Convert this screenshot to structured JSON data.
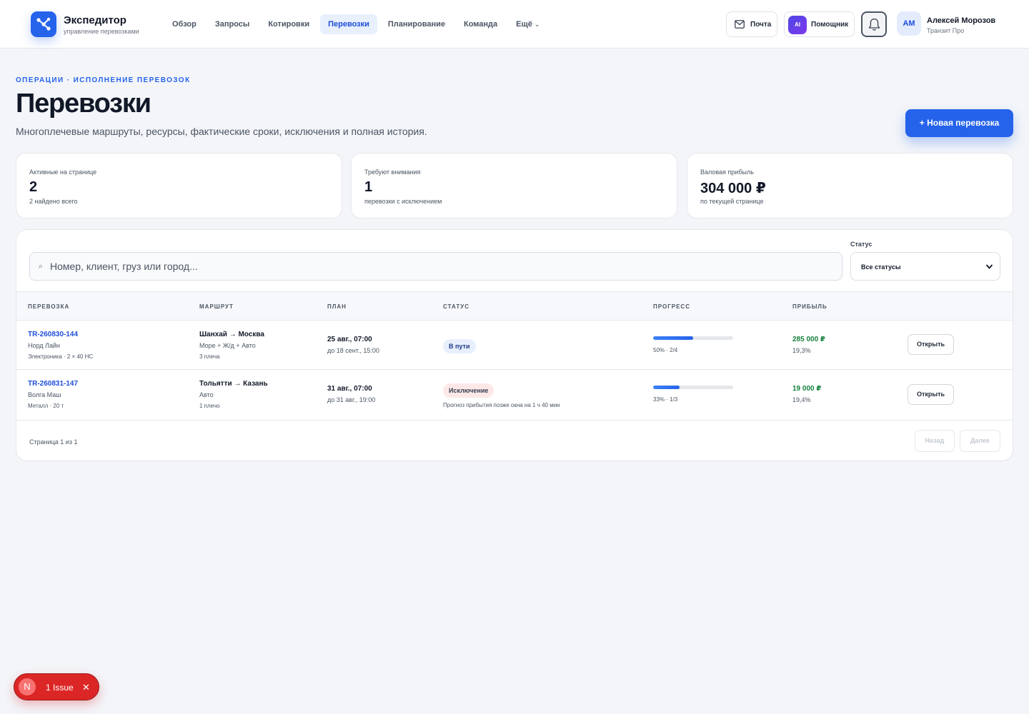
{
  "app": {
    "name": "Экспедитор",
    "subtitle": "управление перевозками"
  },
  "nav": [
    {
      "label": "Обзор"
    },
    {
      "label": "Запросы"
    },
    {
      "label": "Котировки"
    },
    {
      "label": "Перевозки",
      "active": true
    },
    {
      "label": "Планирование"
    },
    {
      "label": "Команда"
    },
    {
      "label": "Ещё"
    }
  ],
  "header_actions": {
    "mail": "Почта",
    "assistant_badge": "AI",
    "assistant": "Помощник"
  },
  "user": {
    "initials": "АМ",
    "name": "Алексей Морозов",
    "org": "Транзит Про"
  },
  "page": {
    "eyebrow": "ОПЕРАЦИИ · ИСПОЛНЕНИЕ ПЕРЕВОЗОК",
    "title": "Перевозки",
    "subtitle": "Многоплечевые маршруты, ресурсы, фактические сроки, исключения и полная история.",
    "new_button": "+ Новая перевозка"
  },
  "stats": [
    {
      "label": "Активные на странице",
      "value": "2",
      "note": "2 найдено всего"
    },
    {
      "label": "Требуют внимания",
      "value": "1",
      "note": "перевозки с исключением"
    },
    {
      "label": "Валовая прибыль",
      "value": "304 000 ₽",
      "note": "по текущей странице"
    }
  ],
  "filters": {
    "search_placeholder": "Номер, клиент, груз или город...",
    "status_label": "Статус",
    "status_value": "Все статусы"
  },
  "table": {
    "headers": [
      "ПЕРЕВОЗКА",
      "МАРШРУТ",
      "ПЛАН",
      "СТАТУС",
      "ПРОГРЕСС",
      "ПРИБЫЛЬ"
    ],
    "rows": [
      {
        "id": "TR-260830-144",
        "client": "Норд Лайн",
        "cargo": "Электроника · 2 × 40 HC",
        "route": "Шанхай → Москва",
        "modes": "Море + Ж/д + Авто",
        "legs": "3 плеча",
        "plan_start": "25 авг., 07:00",
        "plan_end": "до 18 сент., 15:00",
        "status": "В пути",
        "status_note": "",
        "progress": 0.5,
        "progress_text": "50% · 2/4",
        "profit": "285 000 ₽",
        "margin": "19,3%",
        "action": "Открыть"
      },
      {
        "id": "TR-260831-147",
        "client": "Волга Маш",
        "cargo": "Металл · 20 т",
        "route": "Тольятти → Казань",
        "modes": "Авто",
        "legs": "1 плечо",
        "plan_start": "31 авг., 07:00",
        "plan_end": "до 31 авг., 19:00",
        "status": "Исключение",
        "status_note": "Прогноз прибытия позже окна на 1 ч 40 мин",
        "progress": 0.33,
        "progress_text": "33% · 1/3",
        "profit": "19 000 ₽",
        "margin": "19,4%",
        "action": "Открыть"
      }
    ]
  },
  "pagination": {
    "text": "Страница 1 из 1",
    "prev": "Назад",
    "next": "Далее"
  },
  "issue_pill": {
    "logo": "N",
    "label": "1 Issue"
  },
  "colors": {
    "accent": "#2563eb",
    "profit": "#15803d",
    "exception_bg": "#fde8e8",
    "issue": "#dc2626"
  }
}
